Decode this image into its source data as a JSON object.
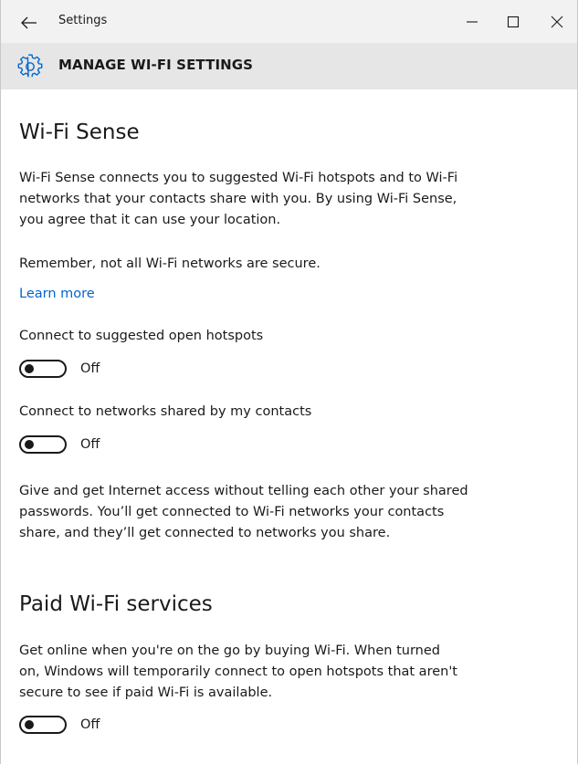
{
  "window": {
    "title": "Settings"
  },
  "header": {
    "heading": "MANAGE WI-FI SETTINGS"
  },
  "wifi_sense": {
    "title": "Wi-Fi Sense",
    "description_lines": [
      "Wi-Fi Sense connects you to suggested Wi-Fi hotspots and to Wi-Fi",
      "networks that your contacts share with you. By using Wi-Fi Sense,",
      "you agree that it can use your location."
    ],
    "warning": "Remember, not all Wi-Fi networks are secure.",
    "learn_more": "Learn more",
    "open_hotspots": {
      "label": "Connect to suggested open hotspots",
      "state": "Off"
    },
    "contacts_networks": {
      "label": "Connect to networks shared by my contacts",
      "state": "Off"
    },
    "sharing_lines": [
      "Give and get Internet access without telling each other your shared",
      "passwords. You’ll get connected to Wi-Fi networks your contacts",
      "share, and they’ll get connected to networks you share."
    ]
  },
  "paid_wifi": {
    "title": "Paid Wi-Fi services",
    "description_lines": [
      "Get online when you're on the go by buying Wi-Fi. When turned",
      "on, Windows will temporarily connect to open hotspots that aren't",
      "secure to see if paid Wi-Fi is available."
    ],
    "toggle": {
      "state": "Off"
    }
  },
  "colors": {
    "link": "#0066cc",
    "title_bar": "#f2f2f2",
    "header_bar": "#e6e6e6",
    "accent_icon": "#0066cc"
  },
  "icons": {
    "back": "back-arrow-icon",
    "minimize": "minimize-icon",
    "maximize": "maximize-icon",
    "close": "close-icon",
    "header": "gear-icon"
  }
}
